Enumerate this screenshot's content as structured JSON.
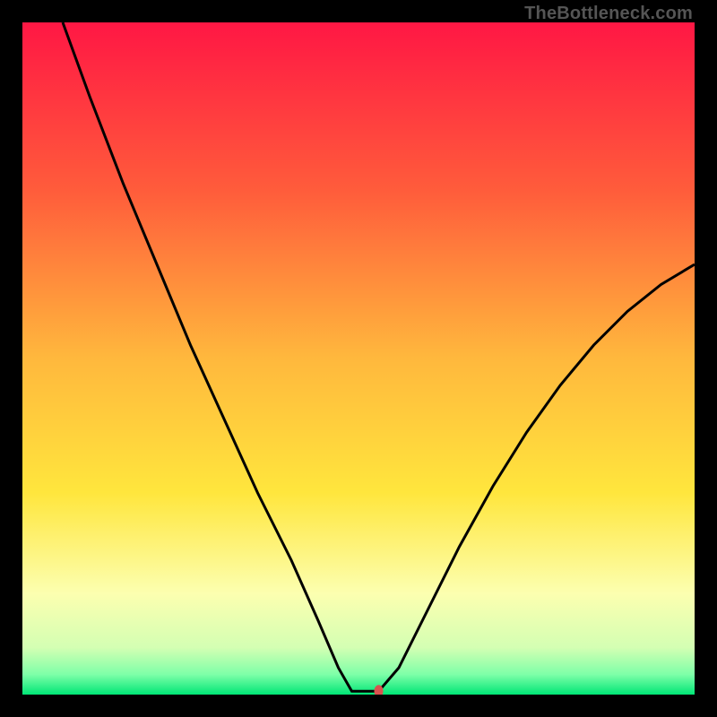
{
  "watermark": "TheBottleneck.com",
  "chart_data": {
    "type": "line",
    "title": "",
    "xlabel": "",
    "ylabel": "",
    "xlim": [
      0,
      100
    ],
    "ylim": [
      0,
      100
    ],
    "background_gradient": {
      "stops": [
        {
          "offset": 0,
          "color": "#ff1744"
        },
        {
          "offset": 25,
          "color": "#ff5c3b"
        },
        {
          "offset": 50,
          "color": "#ffb83d"
        },
        {
          "offset": 70,
          "color": "#ffe63d"
        },
        {
          "offset": 85,
          "color": "#fcffb0"
        },
        {
          "offset": 93,
          "color": "#d4ffb3"
        },
        {
          "offset": 97,
          "color": "#7effa8"
        },
        {
          "offset": 100,
          "color": "#00e676"
        }
      ]
    },
    "series": [
      {
        "name": "bottleneck-curve",
        "color": "#000000",
        "points": [
          {
            "x": 6,
            "y": 100
          },
          {
            "x": 10,
            "y": 89
          },
          {
            "x": 15,
            "y": 76
          },
          {
            "x": 20,
            "y": 64
          },
          {
            "x": 25,
            "y": 52
          },
          {
            "x": 30,
            "y": 41
          },
          {
            "x": 35,
            "y": 30
          },
          {
            "x": 40,
            "y": 20
          },
          {
            "x": 44,
            "y": 11
          },
          {
            "x": 47,
            "y": 4
          },
          {
            "x": 49,
            "y": 0.5
          },
          {
            "x": 53,
            "y": 0.5
          },
          {
            "x": 56,
            "y": 4
          },
          {
            "x": 60,
            "y": 12
          },
          {
            "x": 65,
            "y": 22
          },
          {
            "x": 70,
            "y": 31
          },
          {
            "x": 75,
            "y": 39
          },
          {
            "x": 80,
            "y": 46
          },
          {
            "x": 85,
            "y": 52
          },
          {
            "x": 90,
            "y": 57
          },
          {
            "x": 95,
            "y": 61
          },
          {
            "x": 100,
            "y": 64
          }
        ]
      }
    ],
    "marker": {
      "x": 53,
      "y": 0.5,
      "color": "#d9534f",
      "rx": 5,
      "ry": 7
    }
  }
}
